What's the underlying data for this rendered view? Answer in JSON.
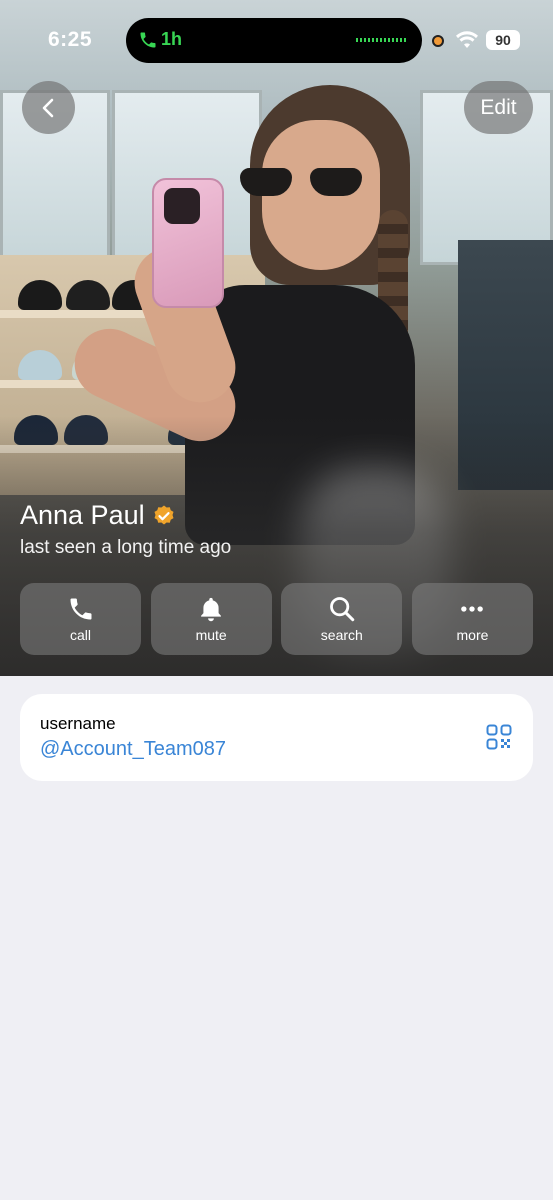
{
  "status_bar": {
    "time": "6:25",
    "call_duration": "1h",
    "battery": "90",
    "call_color": "#38d654"
  },
  "nav": {
    "back_icon": "chevron-left-icon",
    "edit_label": "Edit"
  },
  "profile": {
    "name": "Anna Paul",
    "verified_icon": "verified-badge-icon",
    "verified_color": "#f0a42b",
    "last_seen": "last seen a long time ago"
  },
  "actions": [
    {
      "label": "call",
      "icon": "phone-icon"
    },
    {
      "label": "mute",
      "icon": "bell-icon"
    },
    {
      "label": "search",
      "icon": "search-icon"
    },
    {
      "label": "more",
      "icon": "ellipsis-icon"
    }
  ],
  "username_card": {
    "label": "username",
    "value": "@Account_Team087",
    "value_color": "#3a85d6",
    "qr_icon": "qr-code-icon"
  }
}
